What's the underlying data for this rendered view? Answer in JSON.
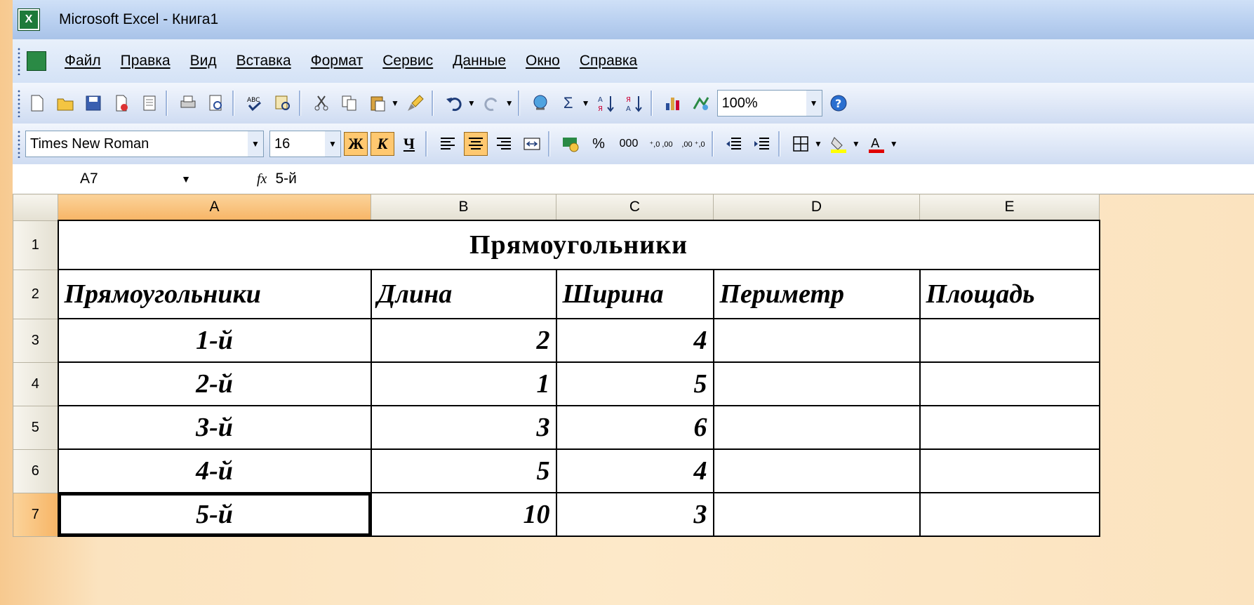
{
  "window": {
    "title": "Microsoft Excel - Книга1"
  },
  "menu": [
    "Файл",
    "Правка",
    "Вид",
    "Вставка",
    "Формат",
    "Сервис",
    "Данные",
    "Окно",
    "Справка"
  ],
  "toolbar": {
    "zoom": "100%"
  },
  "format": {
    "font": "Times New Roman",
    "size": "16",
    "bold": "Ж",
    "italic": "К",
    "underline": "Ч",
    "percent": "%",
    "thousands": "000",
    "inc_dec": "⁺,0 ,00",
    "dec_dec": ",00 ⁺,0"
  },
  "formula_bar": {
    "name_box": "A7",
    "fx": "fx",
    "value": "5-й"
  },
  "columns": [
    "A",
    "B",
    "C",
    "D",
    "E"
  ],
  "selected_column": "A",
  "rows": [
    "1",
    "2",
    "3",
    "4",
    "5",
    "6",
    "7"
  ],
  "sheet": {
    "title": "Прямоугольники",
    "headers": [
      "Прямоугольники",
      "Длина",
      "Ширина",
      "Периметр",
      "Площадь"
    ],
    "data": [
      [
        "1-й",
        "2",
        "4",
        "",
        ""
      ],
      [
        "2-й",
        "1",
        "5",
        "",
        ""
      ],
      [
        "3-й",
        "3",
        "6",
        "",
        ""
      ],
      [
        "4-й",
        "5",
        "4",
        "",
        ""
      ],
      [
        "5-й",
        "10",
        "3",
        "",
        ""
      ]
    ]
  },
  "active_cell": "A7"
}
